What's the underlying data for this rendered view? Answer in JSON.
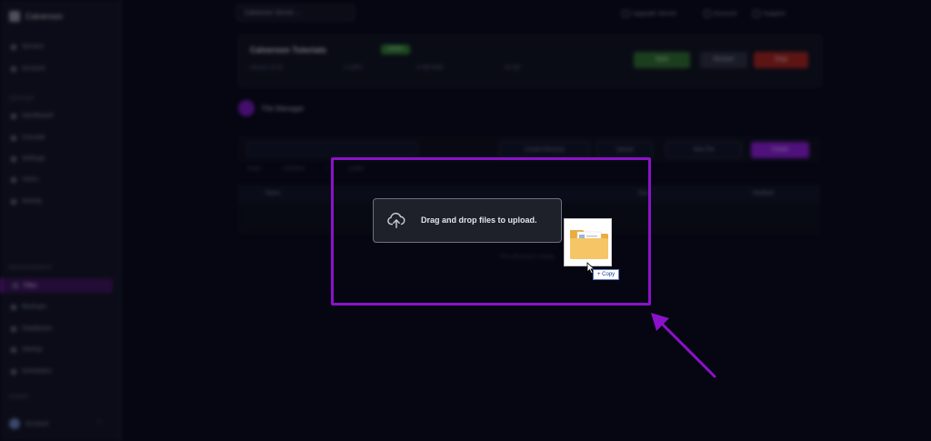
{
  "app": {
    "brand": "Calveroon",
    "sidebar": {
      "top_items": [
        "Servers",
        "Account"
      ],
      "section_1": "SERVER",
      "server_items": [
        "Dashboard",
        "Console",
        "Settings",
        "Users",
        "Activity"
      ],
      "section_2": "MANAGEMENT",
      "management_items": [
        "Files",
        "Backups",
        "Databases",
        "Startup",
        "Schedules"
      ],
      "active_item": "Files",
      "section_3": "ADMIN",
      "user_name": "Account"
    },
    "header": {
      "org_select": "Calveroon Server",
      "links": [
        "Upgrade Server",
        "Account",
        "Support"
      ]
    },
    "project": {
      "title": "Calveroon Tutorials",
      "status": "Online",
      "meta": [
        "Ubuntu 22.04",
        "2 vCPU",
        "4 GB RAM",
        "40 GB"
      ],
      "buttons": {
        "start": "Start",
        "restart": "Restart",
        "stop": "Stop"
      }
    },
    "file_manager": {
      "title": "File Manager",
      "buttons": [
        "Create Directory",
        "Upload",
        "New File",
        "Create"
      ],
      "crumbs": [
        "home",
        "container",
        "/",
        "public"
      ],
      "columns": [
        "Name",
        "Size",
        "Modified"
      ],
      "empty": "This directory is empty."
    }
  },
  "overlay": {
    "drop_message": "Drag and drop files to upload.",
    "copy_tooltip": "+ Copy",
    "colors": {
      "highlight": "#8b12c9",
      "drop_box": "#1e2129",
      "folder": "#f5c566"
    },
    "icons": [
      "upload-cloud-icon",
      "folder-icon",
      "cursor-icon",
      "arrow-icon"
    ]
  }
}
